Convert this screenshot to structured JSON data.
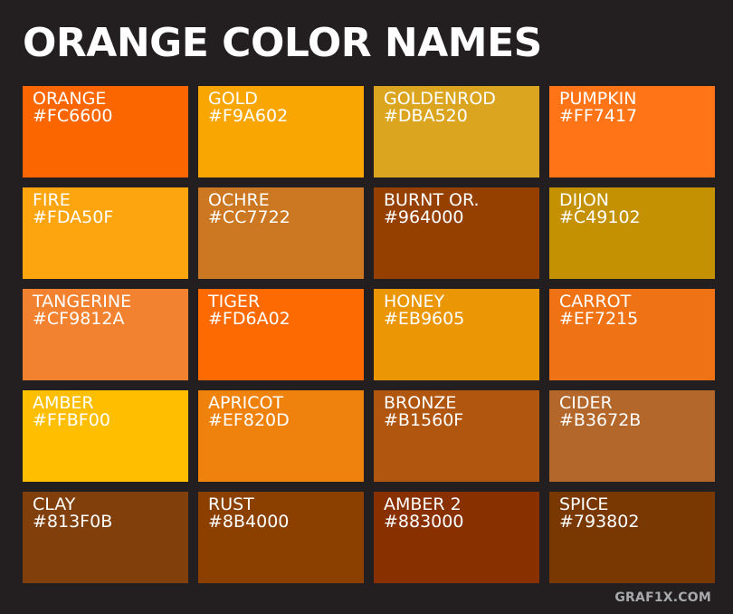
{
  "title": "ORANGE COLOR NAMES",
  "credit": "GRAF1X.COM",
  "swatches": [
    {
      "name": "ORANGE",
      "hex": "#FC6600",
      "color": "#FC6600"
    },
    {
      "name": "GOLD",
      "hex": "#F9A602",
      "color": "#F9A602"
    },
    {
      "name": "GOLDENROD",
      "hex": "#DBA520",
      "color": "#DBA520"
    },
    {
      "name": "PUMPKIN",
      "hex": "#FF7417",
      "color": "#FF7417"
    },
    {
      "name": "FIRE",
      "hex": "#FDA50F",
      "color": "#FDA50F"
    },
    {
      "name": "OCHRE",
      "hex": "#CC7722",
      "color": "#CC7722"
    },
    {
      "name": "BURNT OR.",
      "hex": "#964000",
      "color": "#964000"
    },
    {
      "name": "DIJON",
      "hex": "#C49102",
      "color": "#C49102"
    },
    {
      "name": "TANGERINE",
      "hex": "#CF9812A",
      "color": "#F28230"
    },
    {
      "name": "TIGER",
      "hex": "#FD6A02",
      "color": "#FD6A02"
    },
    {
      "name": "HONEY",
      "hex": "#EB9605",
      "color": "#EB9605"
    },
    {
      "name": "CARROT",
      "hex": "#EF7215",
      "color": "#EF7215"
    },
    {
      "name": "AMBER",
      "hex": "#FFBF00",
      "color": "#FFBF00"
    },
    {
      "name": "APRICOT",
      "hex": "#EF820D",
      "color": "#EF820D"
    },
    {
      "name": "BRONZE",
      "hex": "#B1560F",
      "color": "#B1560F"
    },
    {
      "name": "CIDER",
      "hex": "#B3672B",
      "color": "#B3672B"
    },
    {
      "name": "CLAY",
      "hex": "#813F0B",
      "color": "#813F0B"
    },
    {
      "name": "RUST",
      "hex": "#8B4000",
      "color": "#8B4000"
    },
    {
      "name": "AMBER 2",
      "hex": "#883000",
      "color": "#883000"
    },
    {
      "name": "SPICE",
      "hex": "#793802",
      "color": "#793802"
    }
  ]
}
